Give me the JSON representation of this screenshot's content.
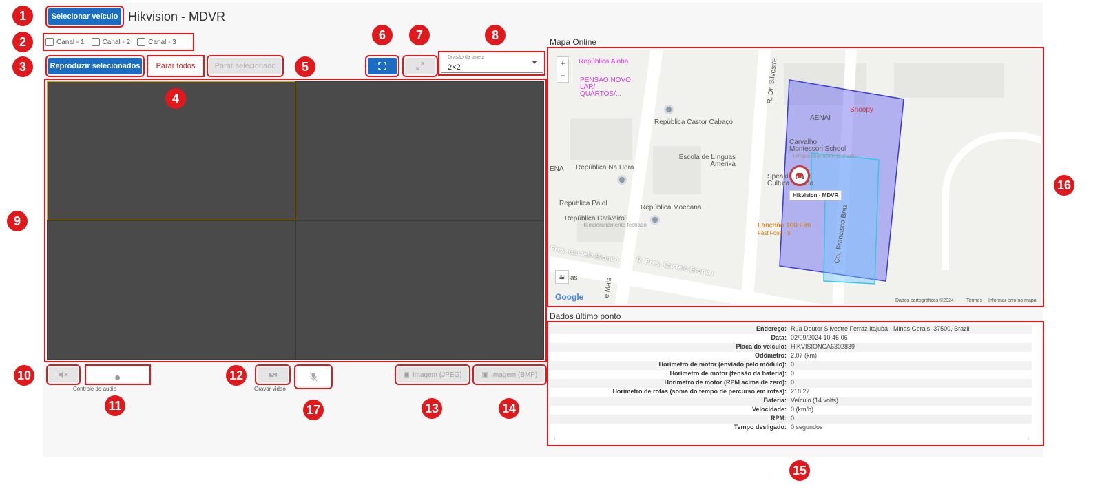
{
  "header": {
    "select_vehicle_label": "Selecionar veículo",
    "title": "Hikvision - MDVR"
  },
  "channels": [
    {
      "label": "Canal - 1"
    },
    {
      "label": "Canal - 2"
    },
    {
      "label": "Canal - 3"
    }
  ],
  "toolbar": {
    "play_selected_label": "Reproduzir selecionados",
    "stop_all_label": "Parar todos",
    "stop_selected_label": "Parar selecionado",
    "window_division_label": "Divisão da janela",
    "window_division_value": "2×2"
  },
  "controls": {
    "audio_control_caption": "Controle de audio",
    "record_caption": "Gravar video",
    "image_jpeg_label": "Imagem (JPEG)",
    "image_bmp_label": "Imagem (BMP)"
  },
  "map": {
    "section_title": "Mapa Online",
    "zoom_in": "+",
    "zoom_out": "−",
    "vehicle_label": "Hikvision - MDVR",
    "google_logo": "Google",
    "layers_label": "as",
    "streets": {
      "dr_silvestre": "R. Dr. Silvestre",
      "castelo_branco_1": "Pres. Castelo Branco",
      "castelo_branco_2": "R. Pres. Castelo Branco",
      "francisco_braz": "Cel. Francisco Braz",
      "maia": "e Maia"
    },
    "pois": {
      "republica_aloba": "República Aloba",
      "pensao": "PENSÃO NOVO LAR/ QUARTOS/...",
      "castor_cabaco": "República Castor Cabaço",
      "aenai": "AENAI",
      "snoopy": "Snoopy",
      "carvalho": "Carvalho Montessori School",
      "temp_fechado": "Temporariamente fechado",
      "escola": "Escola de Línguas Amerika",
      "na_hora": "República Na Hora",
      "ena": "ENA",
      "speaking": "Speaki... ro de Cultura ...icana",
      "paiol": "República Paiol",
      "moecana": "República Moecana",
      "cativeiro": "República Cativeiro",
      "temp_fechado_2": "Temporariamente fechado",
      "lanchao": "Lanchão 100 Fim",
      "fast_food": "Fast Food · $"
    },
    "attribution": {
      "data": "Dados cartográficos ©2024",
      "terms": "Termos",
      "report": "Informar erro no mapa"
    }
  },
  "last_point": {
    "section_title": "Dados último ponto",
    "rows": [
      {
        "key": "Endereço:",
        "value": "Rua Doutor Silvestre Ferraz Itajubá - Minas Gerais, 37500, Brazil"
      },
      {
        "key": "Data:",
        "value": "02/09/2024 10:46:06"
      },
      {
        "key": "Placa do veículo:",
        "value": "HIKVISIONCA6302839"
      },
      {
        "key": "Odômetro:",
        "value": "2,07 (km)"
      },
      {
        "key": "Horímetro de motor (enviado pelo módulo):",
        "value": "0"
      },
      {
        "key": "Horímetro de motor (tensão da bateria):",
        "value": "0"
      },
      {
        "key": "Horímetro de motor (RPM acima de zero):",
        "value": "0"
      },
      {
        "key": "Horímetro de rotas (soma do tempo de percurso em rotas):",
        "value": "218,27"
      },
      {
        "key": "Bateria:",
        "value": "Veículo (14 volts)"
      },
      {
        "key": "Velocidade:",
        "value": "0 (km/h)"
      },
      {
        "key": "RPM:",
        "value": "0"
      },
      {
        "key": "Tempo desligado:",
        "value": "0 segundos"
      }
    ]
  },
  "badges": [
    "1",
    "2",
    "3",
    "4",
    "5",
    "6",
    "7",
    "8",
    "9",
    "10",
    "11",
    "12",
    "13",
    "14",
    "15",
    "16",
    "17"
  ],
  "colors": {
    "primary": "#1a6dc2",
    "annotation_red": "#e0191d",
    "video_bg": "#4a4a4a",
    "geofence_blue": "#3b3bd6",
    "geofence_cyan": "#36c7e6"
  }
}
